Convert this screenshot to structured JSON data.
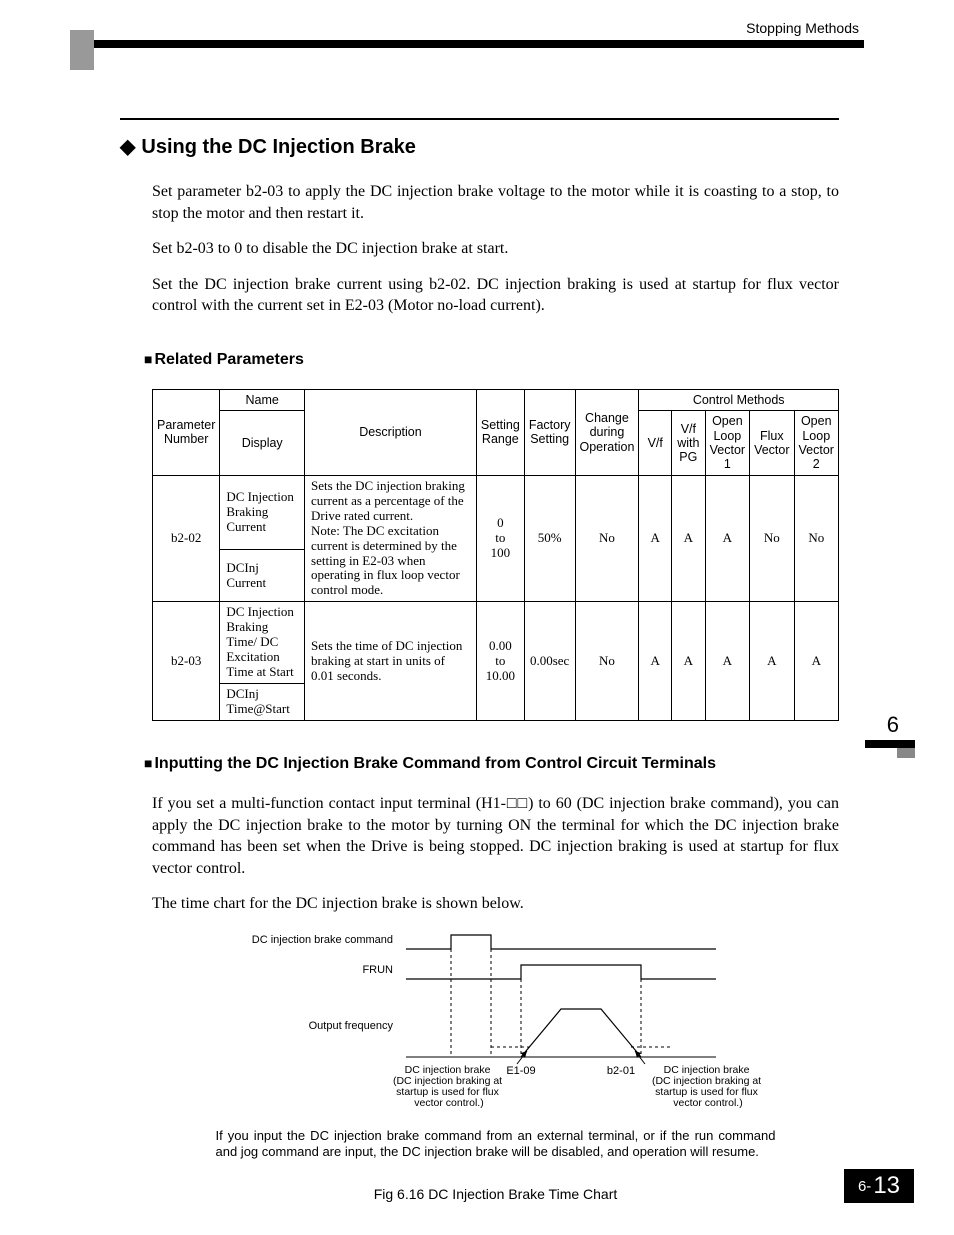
{
  "header": {
    "section_name": "Stopping Methods"
  },
  "section": {
    "title": "Using the DC Injection Brake",
    "paragraphs": [
      "Set parameter b2-03 to apply the DC injection brake voltage to the motor while it is coasting to a stop, to stop the motor and then restart it.",
      "Set b2-03 to 0 to disable the DC injection brake at start.",
      "Set the DC injection brake current using b2-02. DC injection braking is used at startup for flux vector control with the current set in E2-03 (Motor no-load current)."
    ]
  },
  "subsections": {
    "related_params_title": "Related Parameters",
    "inputting_title": "Inputting the DC Injection Brake Command from Control Circuit Terminals",
    "inputting_paragraphs": [
      "If you set a multi-function contact input terminal (H1-□□) to 60 (DC injection brake command), you can apply the DC injection brake to the motor by turning ON the terminal for which the DC injection brake command has been set when the Drive is being stopped. DC injection braking is used at startup for flux vector control.",
      "The time chart for the DC injection brake is shown below."
    ]
  },
  "table": {
    "head": {
      "param_no": "Parameter Number",
      "name": "Name",
      "display": "Display",
      "description": "Description",
      "setting_range": "Setting Range",
      "factory_setting": "Factory Setting",
      "change_during": "Change during Operation",
      "control_methods": "Control Methods",
      "cm": [
        "V/f",
        "V/f with PG",
        "Open Loop Vector 1",
        "Flux Vector",
        "Open Loop Vector 2"
      ]
    },
    "rows": [
      {
        "param_no": "b2-02",
        "name": "DC Injection Braking Current",
        "display": "DCInj Current",
        "description": "Sets the DC injection braking current as a percentage of the Drive rated current.\nNote: The DC excitation current is determined by the setting in E2-03 when operating in flux loop vector control mode.",
        "setting_range": "0\nto\n100",
        "factory_setting": "50%",
        "change_during": "No",
        "cm": [
          "A",
          "A",
          "A",
          "No",
          "No"
        ]
      },
      {
        "param_no": "b2-03",
        "name": "DC Injection Braking Time/ DC Excitation Time at Start",
        "display": "DCInj Time@Start",
        "description": "Sets the time of DC injection braking at start in units of 0.01 seconds.",
        "setting_range": "0.00\nto\n10.00",
        "factory_setting": "0.00sec",
        "change_during": "No",
        "cm": [
          "A",
          "A",
          "A",
          "A",
          "A"
        ]
      }
    ]
  },
  "figure": {
    "labels": {
      "cmd": "DC injection brake command",
      "frun": "FRUN",
      "out_freq": "Output frequency",
      "e1_09": "E1-09",
      "b2_01": "b2-01",
      "left_note": "DC injection brake\n(DC injection braking at startup is used for flux vector control.)",
      "right_note": "DC injection brake\n(DC injection braking at startup is used for flux vector control.)"
    },
    "note": "If you input the DC injection brake command from an external terminal, or if the run command and jog command are input, the DC injection brake will be disabled, and operation will resume.",
    "caption": "Fig 6.16  DC Injection Brake Time Chart"
  },
  "side_marker": {
    "chapter": "6"
  },
  "footer": {
    "prefix": "6-",
    "page": "13"
  }
}
